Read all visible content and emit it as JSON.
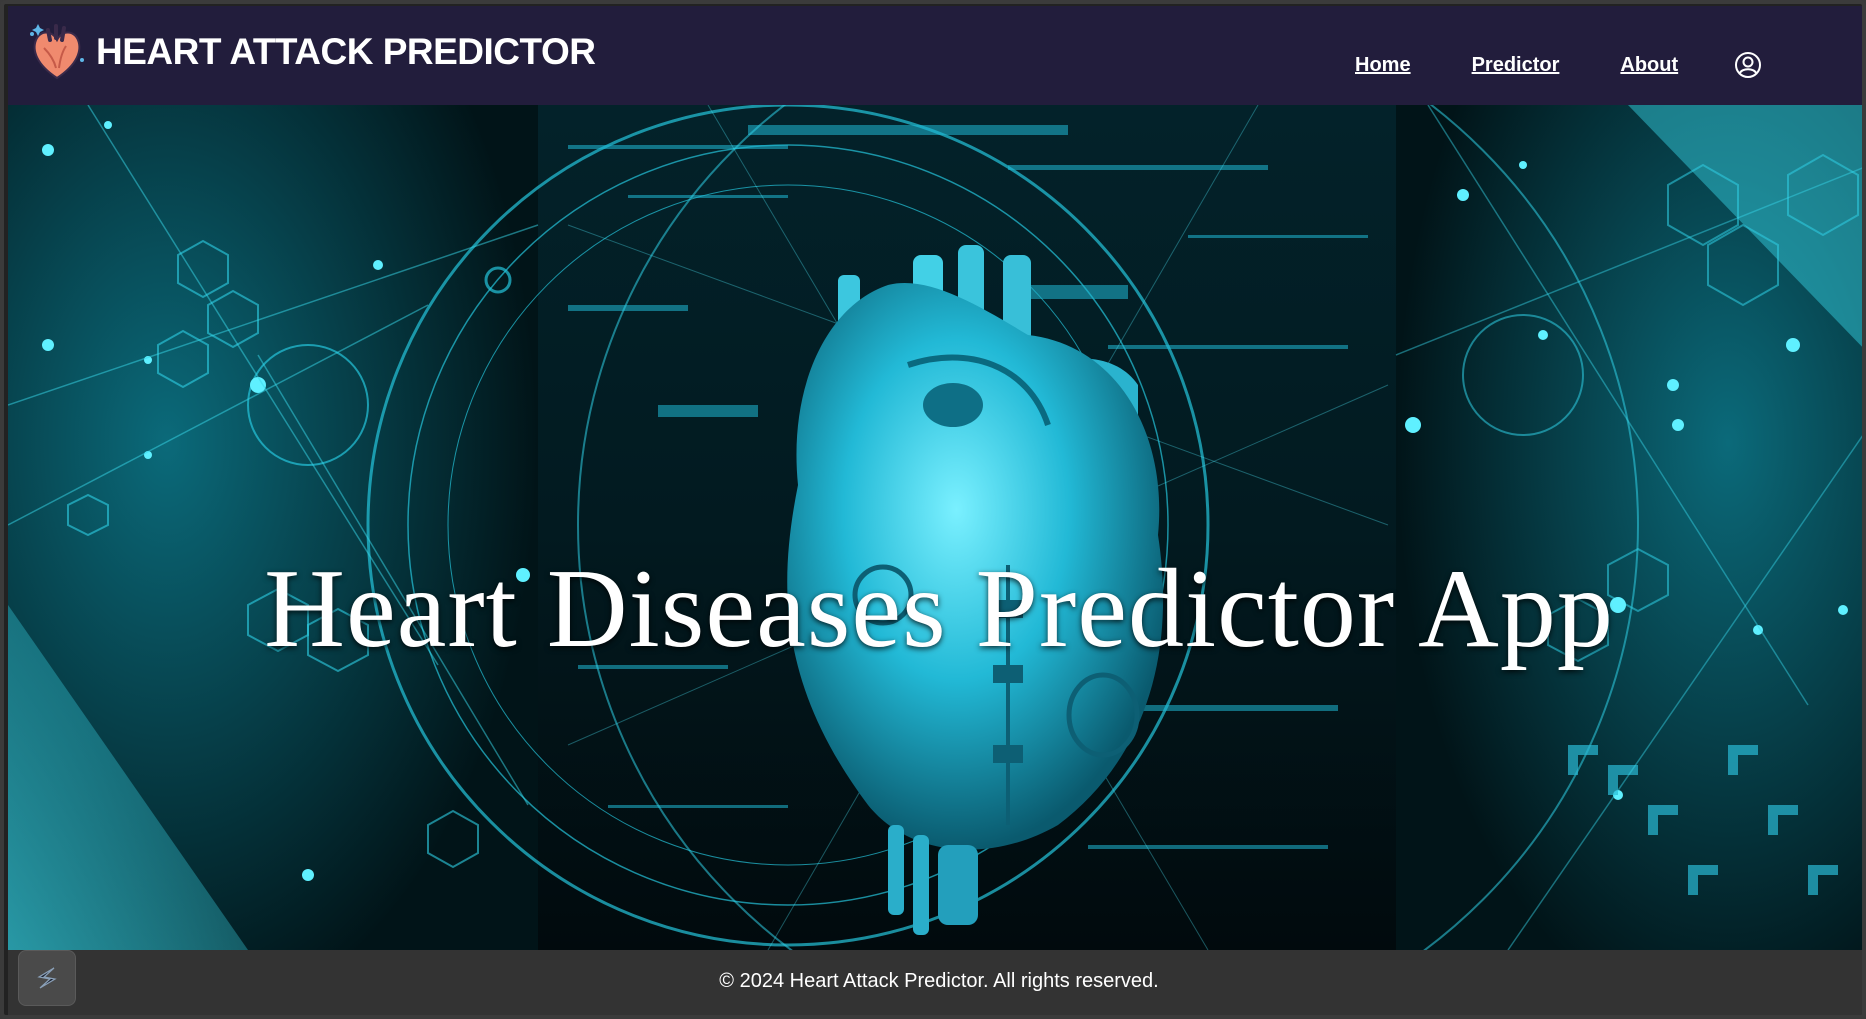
{
  "header": {
    "brand_title": "HEART ATTACK PREDICTOR",
    "logo_icon": "heart-anatomy-icon",
    "nav": [
      {
        "label": "Home"
      },
      {
        "label": "Predictor"
      },
      {
        "label": "About"
      }
    ],
    "account_icon": "user-circle-icon"
  },
  "hero": {
    "title": "Heart Diseases Predictor App",
    "image": "cyan-mechanical-heart-illustration"
  },
  "footer": {
    "copyright": "© 2024 Heart Attack Predictor. All rights reserved.",
    "widget_icon": "streamlit-s-icon"
  },
  "colors": {
    "navbar_bg": "#221d3c",
    "footer_bg": "#333333",
    "accent_cyan": "#1ec8e8"
  }
}
